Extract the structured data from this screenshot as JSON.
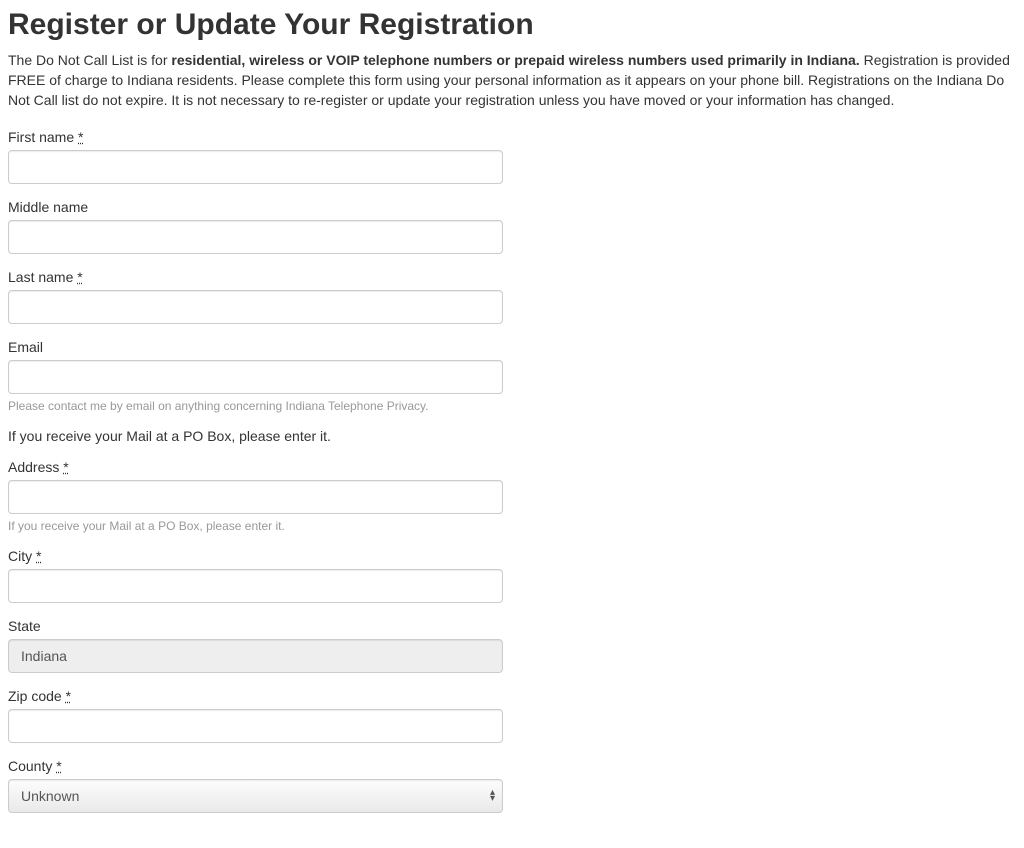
{
  "heading": "Register or Update Your Registration",
  "intro_prefix": "The Do Not Call List is for ",
  "intro_bold": "residential, wireless or VOIP telephone numbers or prepaid wireless numbers used primarily in Indiana.",
  "intro_suffix": " Registration is provided FREE of charge to Indiana residents. Please complete this form using your personal information as it appears on your phone bill. Registrations on the Indiana Do Not Call list do not expire. It is not necessary to re-register or update your registration unless you have moved or your information has changed.",
  "required_mark": "*",
  "fields": {
    "first_name": {
      "label": "First name "
    },
    "middle_name": {
      "label": "Middle name"
    },
    "last_name": {
      "label": "Last name "
    },
    "email": {
      "label": "Email",
      "help": "Please contact me by email on anything concerning Indiana Telephone Privacy."
    },
    "po_box_note": "If you receive your Mail at a PO Box, please enter it.",
    "address": {
      "label": "Address ",
      "help": "If you receive your Mail at a PO Box, please enter it."
    },
    "city": {
      "label": "City "
    },
    "state": {
      "label": "State",
      "value": "Indiana"
    },
    "zip": {
      "label": "Zip code "
    },
    "county": {
      "label": "County ",
      "selected": "Unknown"
    }
  }
}
